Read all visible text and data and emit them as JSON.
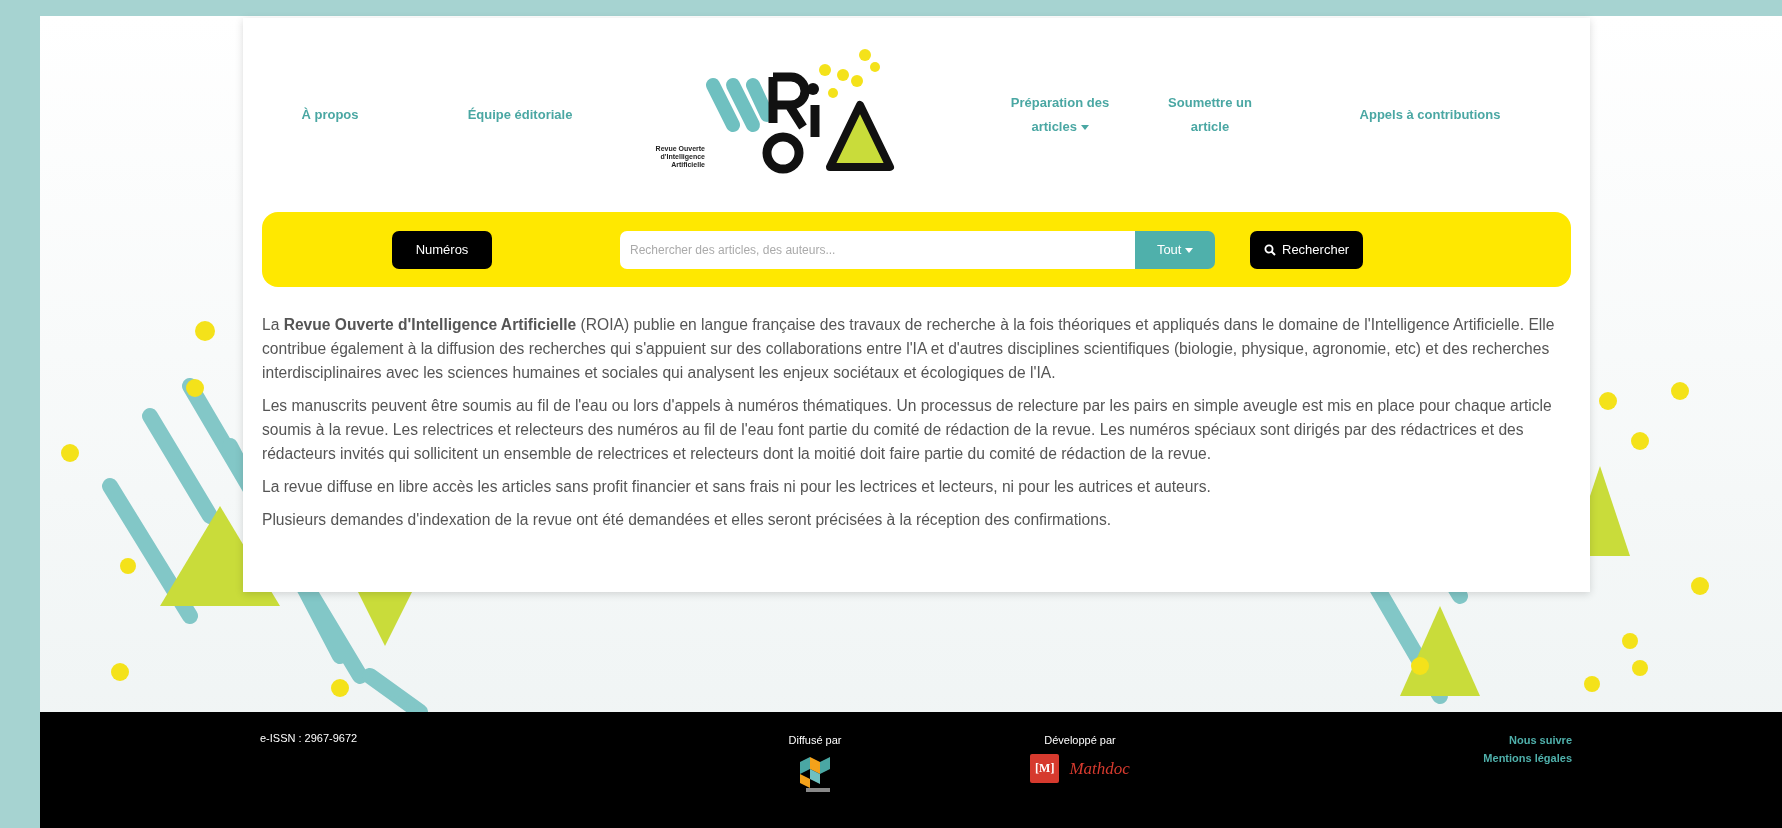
{
  "header": {
    "nav_left": [
      {
        "label": "À propos",
        "dropdown": false
      },
      {
        "label": "Équipe éditoriale",
        "dropdown": false
      }
    ],
    "logo": {
      "caption": "Revue Ouverte d'Intelligence Artificielle"
    },
    "nav_right": [
      {
        "label": "Préparation des articles",
        "dropdown": true
      },
      {
        "label": "Soumettre un article",
        "dropdown": false
      },
      {
        "label": "Appels à contributions",
        "dropdown": false
      }
    ]
  },
  "search_bar": {
    "issues_button": "Numéros",
    "search_field": {
      "placeholder": "Rechercher des articles, des auteurs..."
    },
    "scope_button": "Tout",
    "search_button": "Rechercher"
  },
  "intro": {
    "paragraphs": [
      "La **Revue Ouverte d'Intelligence Artificielle** (ROIA) publie en langue française des travaux de recherche à la fois théoriques et appliqués dans le domaine de l'Intelligence Artificielle. Elle contribue également à la diffusion des recherches qui s'appuient sur des collaborations entre l'IA et d'autres disciplines scientifiques (biologie, physique, agronomie, etc) et des recherches interdisciplinaires avec les sciences humaines et sociales qui analysent les enjeux sociétaux et écologiques de l'IA.",
      "Les manuscrits peuvent être soumis au fil de l'eau ou lors d'appels à numéros thématiques. Un processus de relecture par les pairs en simple aveugle est mis en place pour chaque article soumis à la revue. Les relectrices et relecteurs des numéros au fil de l'eau font partie du comité de rédaction de la revue. Les numéros spéciaux sont dirigés par des rédactrices et des rédacteurs invités qui sollicitent un ensemble de relectrices et relecteurs dont la moitié doit faire partie du comité de rédaction de la revue.",
      "La revue diffuse en libre accès les articles sans profit financier et sans frais ni pour les lectrices et lecteurs, ni pour les autrices et auteurs.",
      "Plusieurs demandes d'indexation de la revue ont été demandées et elles seront précisées à la réception des confirmations."
    ]
  },
  "footer": {
    "issn": "e-ISSN : 2967-9672",
    "distributed_by": "Diffusé par",
    "developed_by": "Développé par",
    "mathdoc_mark": "[M]",
    "mathdoc_name": "Mathdoc",
    "links": [
      "Nous suivre",
      "Mentions légales"
    ]
  }
}
